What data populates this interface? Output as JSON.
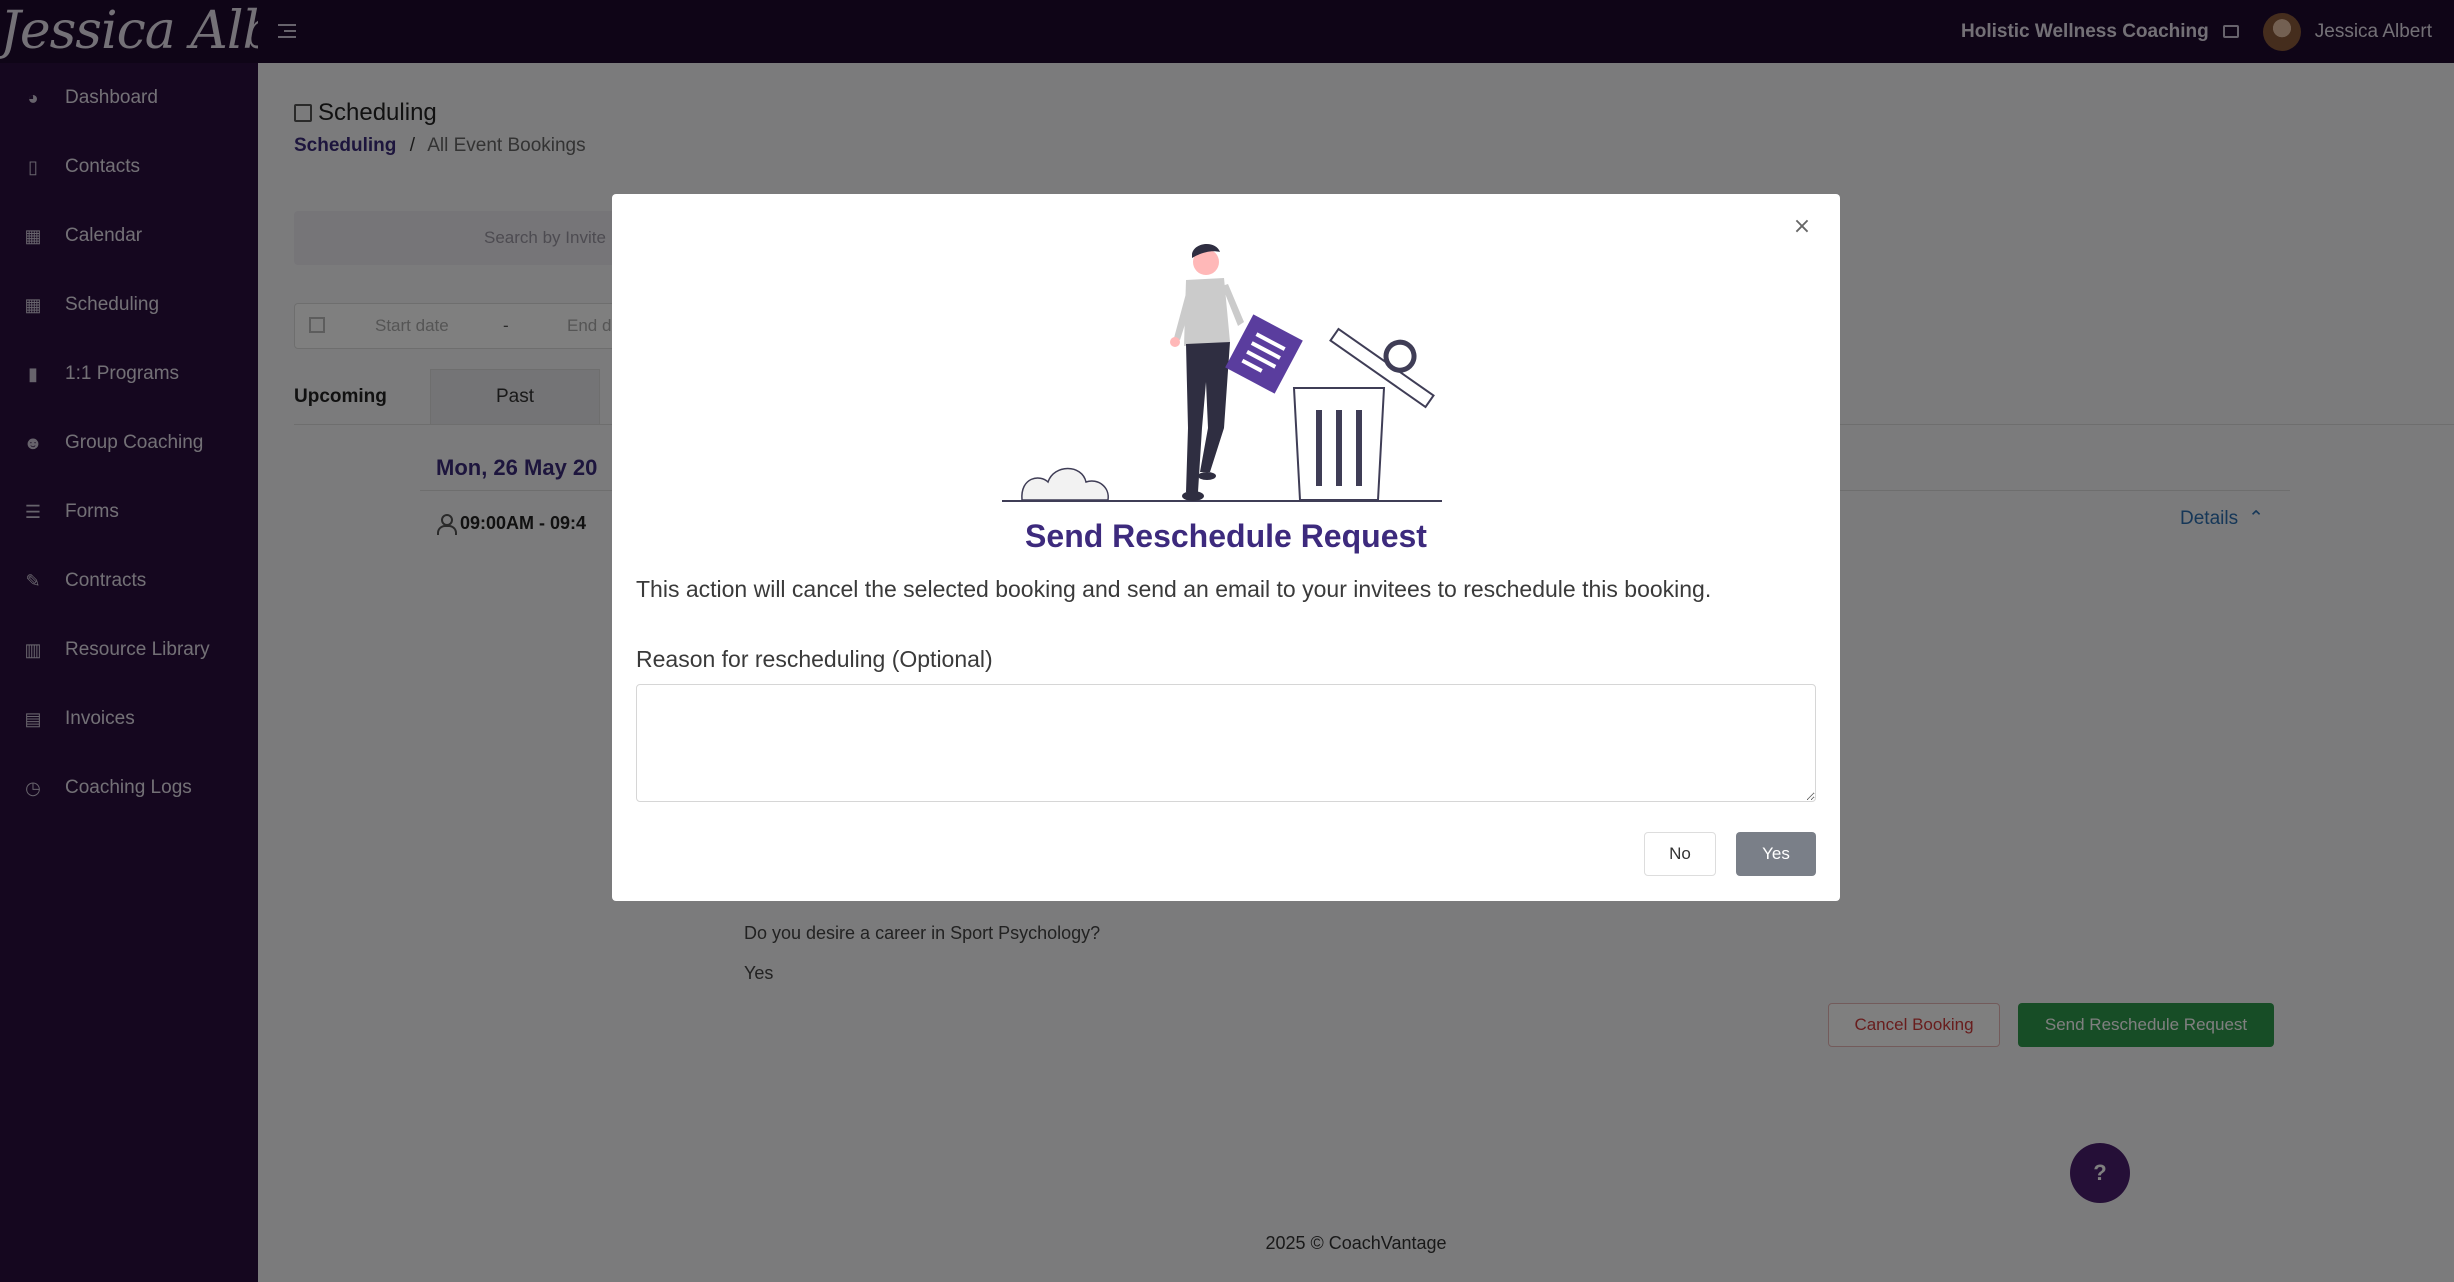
{
  "topbar": {
    "logo_text": "Jessica Albert",
    "business_name": "Holistic Wellness Coaching",
    "user_name": "Jessica Albert"
  },
  "sidebar": {
    "items": [
      {
        "label": "Dashboard",
        "icon": "dashboard-icon"
      },
      {
        "label": "Contacts",
        "icon": "contacts-icon"
      },
      {
        "label": "Calendar",
        "icon": "calendar-icon"
      },
      {
        "label": "Scheduling",
        "icon": "scheduling-icon"
      },
      {
        "label": "1:1 Programs",
        "icon": "programs-icon"
      },
      {
        "label": "Group Coaching",
        "icon": "group-icon"
      },
      {
        "label": "Forms",
        "icon": "forms-icon"
      },
      {
        "label": "Contracts",
        "icon": "contracts-icon"
      },
      {
        "label": "Resource Library",
        "icon": "library-icon"
      },
      {
        "label": "Invoices",
        "icon": "invoices-icon"
      },
      {
        "label": "Coaching Logs",
        "icon": "clock-icon"
      }
    ]
  },
  "page": {
    "title": "Scheduling",
    "breadcrumb_link": "Scheduling",
    "breadcrumb_sep": "/",
    "breadcrumb_current": "All Event Bookings",
    "search_placeholder": "Search by Invite",
    "start_date_placeholder": "Start date",
    "date_separator": "-",
    "end_date_placeholder": "End d",
    "tabs": [
      "Upcoming",
      "Past"
    ],
    "date_heading": "Mon, 26 May 20",
    "booking_time": "09:00AM - 09:4",
    "details_label": "Details",
    "question": "Do you desire a career in Sport Psychology?",
    "answer": "Yes",
    "cancel_booking_label": "Cancel Booking",
    "send_reschedule_label": "Send Reschedule Request",
    "footer": "2025 © CoachVantage",
    "help_label": "?"
  },
  "modal": {
    "title": "Send Reschedule Request",
    "description": "This action will cancel the selected booking and send an email to your invitees to reschedule this booking.",
    "reason_label": "Reason for rescheduling (Optional)",
    "reason_value": "",
    "no_label": "No",
    "yes_label": "Yes",
    "close_symbol": "×"
  },
  "colors": {
    "topbar_bg": "#1e0a2e",
    "sidebar_bg": "#2a0f3e",
    "modal_title": "#3d2a7d",
    "accent_purple": "#4a2d86",
    "success_green": "#2f9b4c",
    "danger_red": "#d03b3b"
  }
}
